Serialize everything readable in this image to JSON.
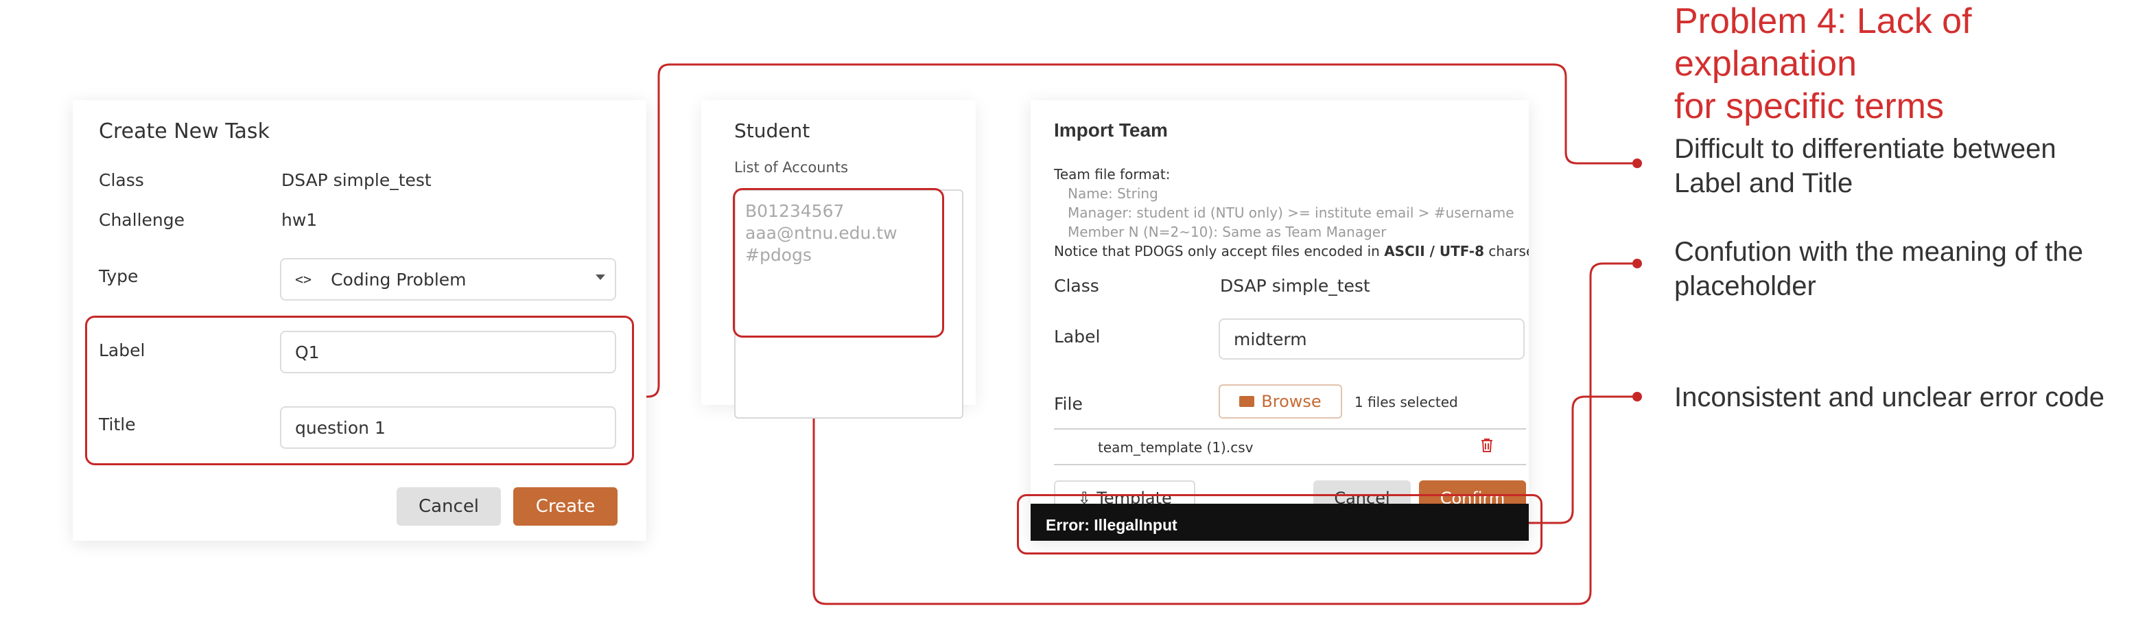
{
  "create_task": {
    "title": "Create New Task",
    "class_label": "Class",
    "class_value": "DSAP simple_test",
    "challenge_label": "Challenge",
    "challenge_value": "hw1",
    "type_label": "Type",
    "type_value": "Coding Problem",
    "type_icon": "code-icon",
    "label_label": "Label",
    "label_value": "Q1",
    "title_label": "Title",
    "title_value": "question 1",
    "cancel": "Cancel",
    "create": "Create"
  },
  "student": {
    "title": "Student",
    "list_label": "List of Accounts",
    "placeholder_line1": "B01234567",
    "placeholder_line2": "aaa@ntnu.edu.tw",
    "placeholder_line3": "#pdogs"
  },
  "import_team": {
    "title": "Import Team",
    "format_heading": "Team file format:",
    "format_name": "Name: String",
    "format_manager": "Manager: student id (NTU only) >= institute email > #username",
    "format_member": "Member N (N=2~10): Same as Team Manager",
    "notice_prefix": "Notice that PDOGS only accept files encoded in ",
    "notice_bold": "ASCII / UTF-8",
    "notice_suffix": " charset.",
    "class_label": "Class",
    "class_value": "DSAP simple_test",
    "label_label": "Label",
    "label_value": "midterm",
    "file_label": "File",
    "browse": "Browse",
    "files_selected": "1 files selected",
    "file_name": "team_template (1).csv",
    "template": "Template",
    "cancel": "Cancel",
    "confirm": "Confirm",
    "error": "Error: IllegalInput"
  },
  "annotations": {
    "heading_line1": "Problem 4: Lack of explanation",
    "heading_line2": "for specific terms",
    "point1_line1": "Difficult to differentiate between",
    "point1_line2": "Label and Title",
    "point2_line1": "Confution with the meaning of the",
    "point2_line2": "placeholder",
    "point3": "Inconsistent and unclear error code"
  },
  "colors": {
    "annotation_red": "#c62828",
    "heading_red": "#d32f2f",
    "accent_orange": "#c56b35",
    "error_bg": "#111111"
  }
}
